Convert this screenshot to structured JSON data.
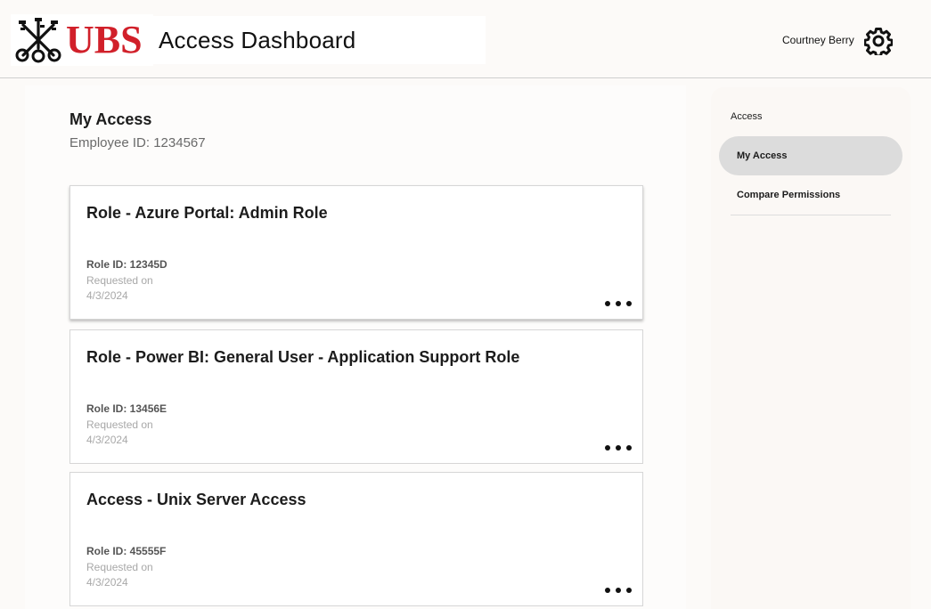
{
  "header": {
    "brand": "UBS",
    "app_title": "Access Dashboard",
    "user_name": "Courtney Berry",
    "settings_icon": "gear-icon",
    "logo_icon": "crossed-keys-icon",
    "brand_color": "#d1202a"
  },
  "main": {
    "title": "My Access",
    "employee_id": "Employee ID: 1234567",
    "cards": [
      {
        "title": "Role - Azure Portal: Admin Role",
        "role_id": "Role ID: 12345D",
        "requested_label": "Requested on",
        "requested_date": "4/3/2024",
        "menu_icon": "more-options-icon"
      },
      {
        "title": "Role - Power BI: General User - Application Support Role",
        "role_id": "Role ID: 13456E",
        "requested_label": "Requested on",
        "requested_date": "4/3/2024",
        "menu_icon": "more-options-icon"
      },
      {
        "title": "Access - Unix Server Access",
        "role_id": "Role ID: 45555F",
        "requested_label": "Requested on",
        "requested_date": "4/3/2024",
        "menu_icon": "more-options-icon"
      }
    ]
  },
  "sidebar": {
    "heading": "Access",
    "items": [
      {
        "label": "My Access",
        "active": true
      },
      {
        "label": "Compare Permissions",
        "active": false
      }
    ],
    "active_color": "#dcdcdc"
  }
}
